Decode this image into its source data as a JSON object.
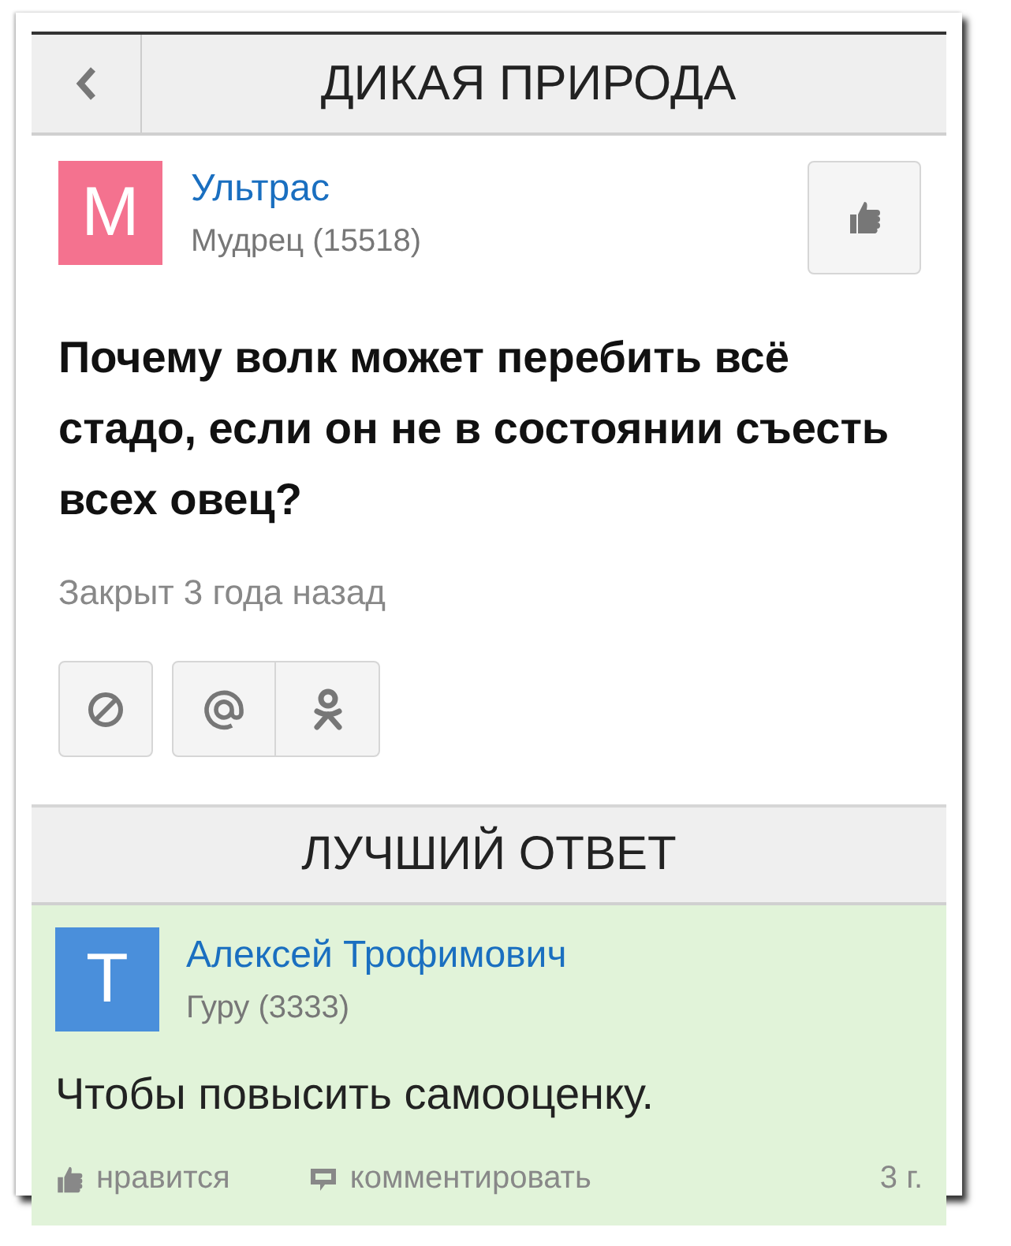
{
  "header": {
    "title": "ДИКАЯ ПРИРОДА"
  },
  "question": {
    "author": {
      "initial": "М",
      "name": "Ультрас",
      "rank": "Мудрец (15518)"
    },
    "text": "Почему волк может перебить всё стадо, если он не в состоянии съесть всех овец?",
    "status": "Закрыт 3 года назад"
  },
  "best_answer": {
    "heading": "ЛУЧШИЙ ОТВЕТ",
    "author": {
      "initial": "Т",
      "name": "Алексей Трофимович",
      "rank": "Гуру (3333)"
    },
    "text": "Чтобы повысить самооценку.",
    "like_label": "нравится",
    "comment_label": "комментировать",
    "age": "3 г."
  }
}
